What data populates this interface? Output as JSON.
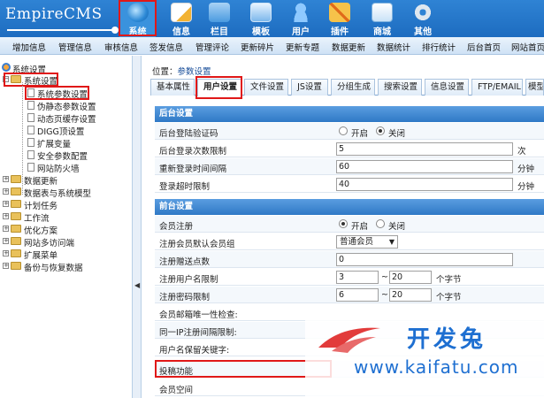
{
  "header": {
    "logo": "EmpireCMS",
    "nav": [
      {
        "label": "系统",
        "icon": "globe-icon"
      },
      {
        "label": "信息",
        "icon": "document-edit-icon"
      },
      {
        "label": "栏目",
        "icon": "folder-icon"
      },
      {
        "label": "模板",
        "icon": "template-icon"
      },
      {
        "label": "用户",
        "icon": "user-icon"
      },
      {
        "label": "插件",
        "icon": "plugin-icon"
      },
      {
        "label": "商城",
        "icon": "shop-icon"
      },
      {
        "label": "其他",
        "icon": "gear-icon"
      }
    ]
  },
  "subnav": [
    "增加信息",
    "管理信息",
    "审核信息",
    "签发信息",
    "管理评论",
    "更新碎片",
    "更新专题",
    "数据更新",
    "数据统计",
    "排行统计",
    "后台首页",
    "网站首页"
  ],
  "sidebar": {
    "root": "系统设置",
    "children": [
      "系统参数设置",
      "伪静态参数设置",
      "动态页缓存设置",
      "DIGG顶设置",
      "扩展变量",
      "安全参数配置",
      "网站防火墙"
    ],
    "groups": [
      "数据更新",
      "数据表与系统模型",
      "计划任务",
      "工作流",
      "优化方案",
      "网站多访问端",
      "扩展菜单",
      "备份与恢复数据"
    ]
  },
  "main": {
    "location_label": "位置：",
    "location_link": "参数设置",
    "tabs": [
      "基本属性",
      "用户设置",
      "文件设置",
      "JS设置",
      "分组生成",
      "搜索设置",
      "信息设置",
      "FTP/EMAIL",
      "模型"
    ],
    "admin_section": "后台设置",
    "admin": {
      "captcha_label": "后台登陆验证码",
      "captcha_on": "开启",
      "captcha_off": "关闭",
      "login_limit_label": "后台登录次数限制",
      "login_limit_value": "5",
      "login_limit_unit": "次",
      "relogin_label": "重新登录时间间隔",
      "relogin_value": "60",
      "relogin_unit": "分钟",
      "timeout_label": "登录超时限制",
      "timeout_value": "40",
      "timeout_unit": "分钟"
    },
    "front_section": "前台设置",
    "front": {
      "register_label": "会员注册",
      "register_on": "开启",
      "register_off": "关闭",
      "default_group_label": "注册会员默认会员组",
      "default_group_value": "普通会员",
      "gift_points_label": "注册赠送点数",
      "gift_points_value": "0",
      "username_len_label": "注册用户名限制",
      "username_min": "3",
      "username_max": "20",
      "username_unit": "个字节",
      "password_len_label": "注册密码限制",
      "password_min": "6",
      "password_max": "20",
      "password_unit": "个字节",
      "tilde": "~",
      "email_unique_label": "会员邮箱唯一性检查:",
      "ip_interval_label": "同一IP注册间隔限制:",
      "reserved_words_label": "用户名保留关键字:",
      "submit_label": "投稿功能",
      "space_label": "会员空间"
    }
  },
  "watermark": {
    "cn": "开发兔",
    "en": "www.kaifatu.com"
  },
  "colors": {
    "header": "#1d6cc0",
    "section": "#2f79c6",
    "highlight": "#e01818"
  }
}
